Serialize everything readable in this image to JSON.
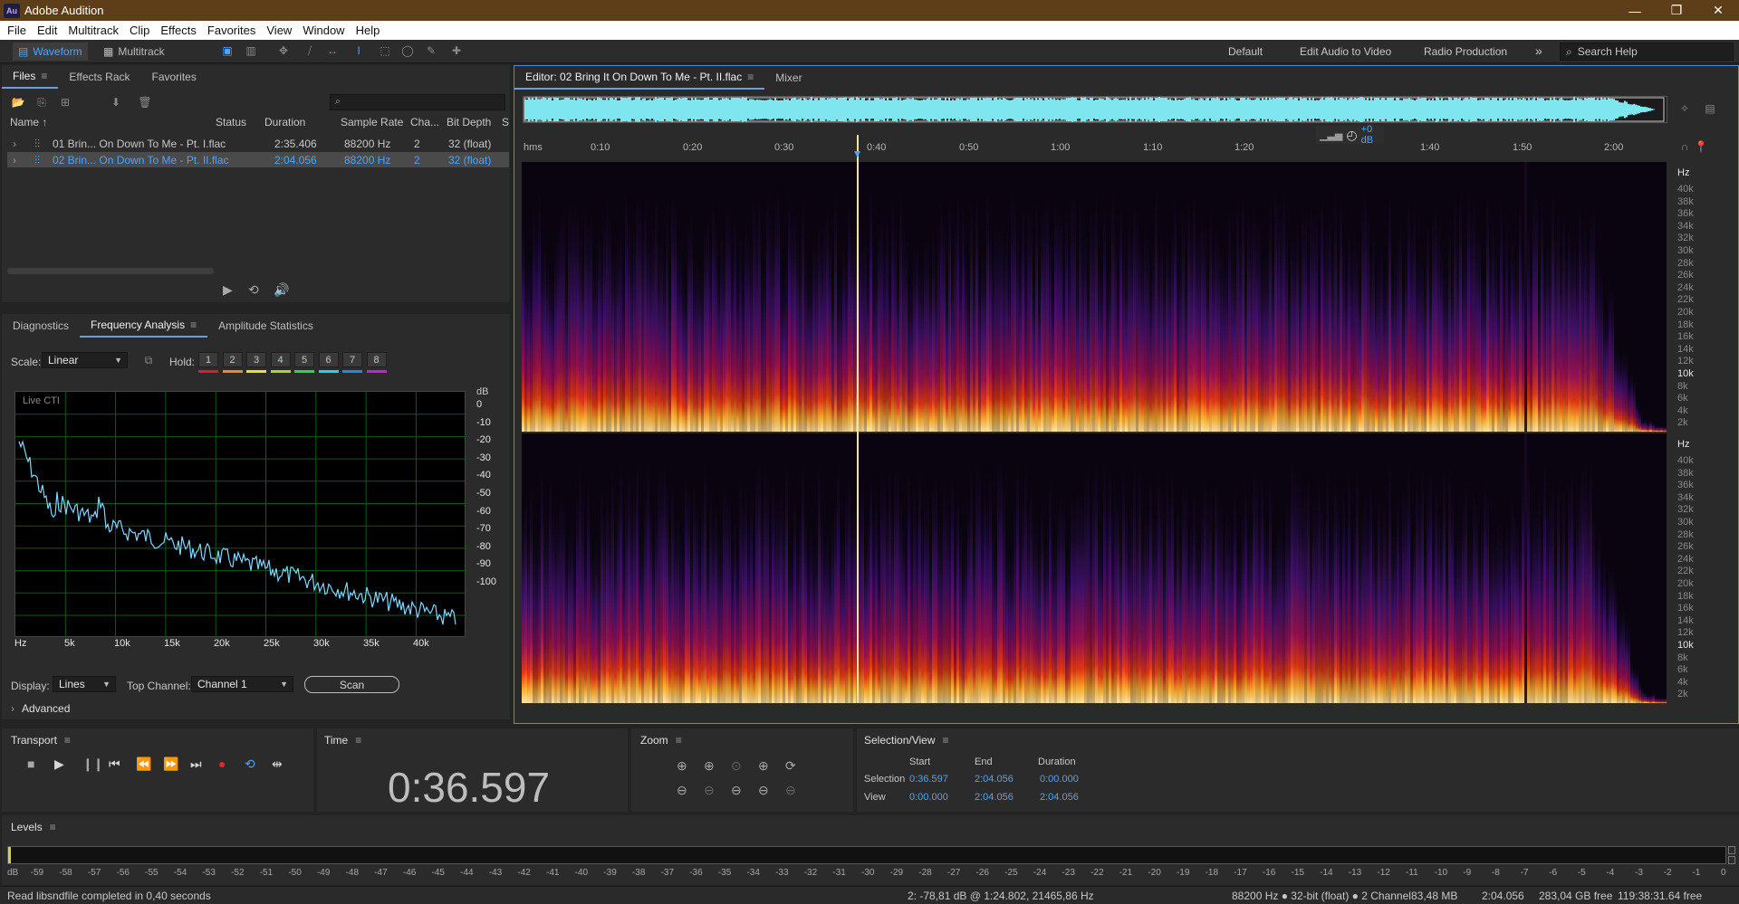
{
  "window": {
    "title": "Adobe Audition",
    "app_badge": "Au",
    "minimize": "—",
    "maximize": "❐",
    "close": "✕"
  },
  "menu": [
    "File",
    "Edit",
    "Multitrack",
    "Clip",
    "Effects",
    "Favorites",
    "View",
    "Window",
    "Help"
  ],
  "toolbar": {
    "waveform": "Waveform",
    "multitrack": "Multitrack",
    "workspaces": [
      "Default",
      "Edit Audio to Video",
      "Radio Production"
    ],
    "more": "»",
    "search_placeholder": "Search Help"
  },
  "files_panel": {
    "tabs": [
      "Files",
      "Effects Rack",
      "Favorites"
    ],
    "columns": [
      "Name ↑",
      "Status",
      "Duration",
      "Sample Rate",
      "Cha...",
      "Bit Depth",
      "S"
    ],
    "search_placeholder": "",
    "rows": [
      {
        "name": "01 Brin... On Down To Me - Pt. I.flac",
        "status": "",
        "duration": "2:35.406",
        "sample_rate": "88200 Hz",
        "channels": "2",
        "bit_depth": "32 (float)",
        "selected": false
      },
      {
        "name": "02 Brin... On Down To Me - Pt. II.flac",
        "status": "",
        "duration": "2:04.056",
        "sample_rate": "88200 Hz",
        "channels": "2",
        "bit_depth": "32 (float)",
        "selected": true
      }
    ]
  },
  "analysis_panel": {
    "tabs": [
      "Diagnostics",
      "Frequency Analysis",
      "Amplitude Statistics"
    ],
    "scale_label": "Scale:",
    "scale_value": "Linear",
    "hold_label": "Hold:",
    "hold_buttons": [
      "1",
      "2",
      "3",
      "4",
      "5",
      "6",
      "7",
      "8"
    ],
    "hold_colors": [
      "#e0201c",
      "#f08a1c",
      "#f0e01c",
      "#9ce01c",
      "#1ce03c",
      "#1cd8e0",
      "#1c8ce0",
      "#d01ce0"
    ],
    "graph_label": "Live CTI",
    "db_unit": "dB",
    "db_ticks": [
      "0",
      "-10",
      "-20",
      "-30",
      "-40",
      "-50",
      "-60",
      "-70",
      "-80",
      "-90",
      "-100"
    ],
    "hz_ticks": [
      "Hz",
      "5k",
      "10k",
      "15k",
      "20k",
      "25k",
      "30k",
      "35k",
      "40k"
    ],
    "display_label": "Display:",
    "display_value": "Lines",
    "top_channel_label": "Top Channel:",
    "top_channel_value": "Channel 1",
    "scan_button": "Scan",
    "advanced_label": "Advanced",
    "line_color": "#7fd7ff"
  },
  "editor": {
    "tab": "Editor: 02 Bring It On Down To Me - Pt. II.flac",
    "mixer_tab": "Mixer",
    "time_ticks": [
      "hms",
      "0:10",
      "0:20",
      "0:30",
      "0:40",
      "0:50",
      "1:00",
      "1:10",
      "1:20",
      "1:40",
      "1:50",
      "2:00"
    ],
    "gain": "+0 dB",
    "playhead_seconds": 36.597,
    "total_seconds": 124.056,
    "hz_labels": [
      "Hz",
      "40k",
      "38k",
      "36k",
      "34k",
      "32k",
      "30k",
      "28k",
      "26k",
      "24k",
      "22k",
      "20k",
      "18k",
      "16k",
      "14k",
      "12k",
      "10k",
      "8k",
      "6k",
      "4k",
      "2k"
    ]
  },
  "transport": {
    "title": "Transport"
  },
  "time_panel": {
    "title": "Time",
    "value": "0:36.597"
  },
  "zoom_panel": {
    "title": "Zoom"
  },
  "selection_view": {
    "title": "Selection/View",
    "headers": [
      "Start",
      "End",
      "Duration"
    ],
    "selection_label": "Selection",
    "selection": [
      "0:36.597",
      "2:04.056",
      "0:00.000"
    ],
    "view_label": "View",
    "view": [
      "0:00.000",
      "2:04.056",
      "2:04.056"
    ]
  },
  "levels": {
    "title": "Levels",
    "scale": [
      "dB",
      "-59",
      "-58",
      "-57",
      "-56",
      "-55",
      "-54",
      "-53",
      "-52",
      "-51",
      "-50",
      "-49",
      "-48",
      "-47",
      "-46",
      "-45",
      "-44",
      "-43",
      "-42",
      "-41",
      "-40",
      "-39",
      "-38",
      "-37",
      "-36",
      "-35",
      "-34",
      "-33",
      "-32",
      "-31",
      "-30",
      "-29",
      "-28",
      "-27",
      "-26",
      "-25",
      "-24",
      "-23",
      "-22",
      "-21",
      "-20",
      "-19",
      "-18",
      "-17",
      "-16",
      "-15",
      "-14",
      "-13",
      "-12",
      "-11",
      "-10",
      "-9",
      "-8",
      "-7",
      "-6",
      "-5",
      "-4",
      "-3",
      "-2",
      "-1",
      "0"
    ]
  },
  "status": {
    "message": "Read libsndfile completed in 0,40 seconds",
    "cursor_info": "2: -78,81 dB @ 1:24.802, 21465,86 Hz",
    "format": "88200 Hz ● 32-bit (float) ● 2 Channel",
    "size": "83,48 MB",
    "duration": "2:04.056",
    "free": "283,04 GB free",
    "time_free": "119:38:31.64 free"
  }
}
